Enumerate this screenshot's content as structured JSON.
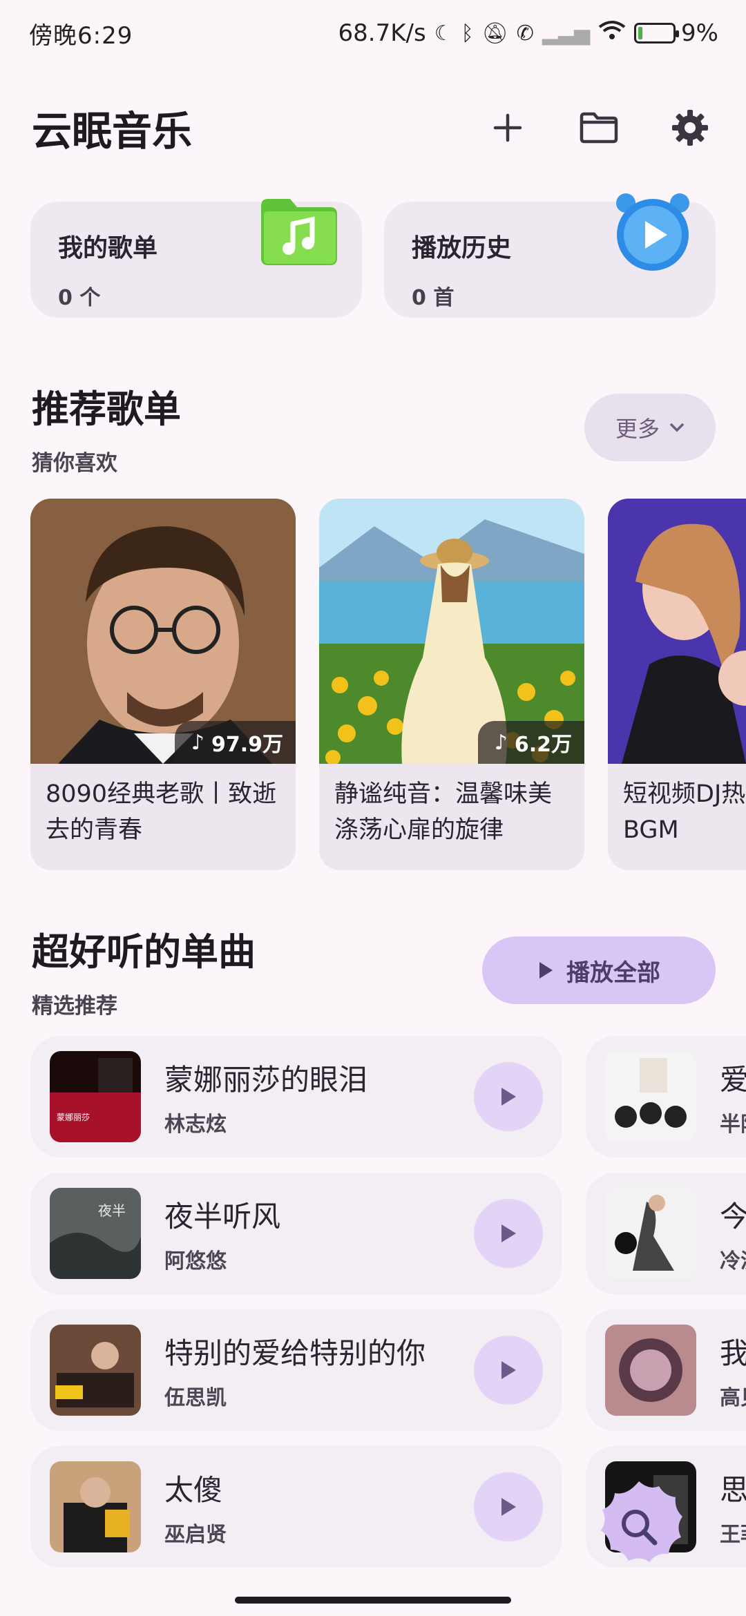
{
  "status": {
    "time": "傍晚6:29",
    "net_speed": "68.7K/s",
    "battery": "9%"
  },
  "app": {
    "title": "云眠音乐",
    "actions": [
      "add-icon",
      "folder-icon",
      "settings-icon"
    ]
  },
  "quick": [
    {
      "title": "我的歌单",
      "sub": "0 个",
      "icon": "music-folder-icon"
    },
    {
      "title": "播放历史",
      "sub": "0 首",
      "icon": "alarm-clock-play-icon"
    }
  ],
  "recommend": {
    "title": "推荐歌单",
    "subtitle": "猜你喜欢",
    "more_label": "更多",
    "playlists": [
      {
        "title": "8090经典老歌丨致逝去的青春",
        "count": "97.9万"
      },
      {
        "title": "静谧纯音：温馨味美涤荡心扉的旋律",
        "count": "6.2万"
      },
      {
        "title": "短视频DJ热歌丨网红BGM",
        "count": ""
      }
    ]
  },
  "singles": {
    "title": "超好听的单曲",
    "subtitle": "精选推荐",
    "play_all_label": "播放全部",
    "songs": [
      {
        "title": "蒙娜丽莎的眼泪",
        "artist": "林志炫"
      },
      {
        "title": "爱你",
        "artist": "半阳"
      },
      {
        "title": "夜半听风",
        "artist": "阿悠悠"
      },
      {
        "title": "今天",
        "artist": "冷漠"
      },
      {
        "title": "特别的爱给特别的你",
        "artist": "伍思凯"
      },
      {
        "title": "我",
        "artist": "高见"
      },
      {
        "title": "太傻",
        "artist": "巫启贤"
      },
      {
        "title": "思念",
        "artist": "王菲"
      }
    ]
  },
  "colors": {
    "background": "#FCF6FB",
    "card": "#EFE8F1",
    "accent": "#D8C7F6",
    "play_icon": "#6B5A8A"
  }
}
